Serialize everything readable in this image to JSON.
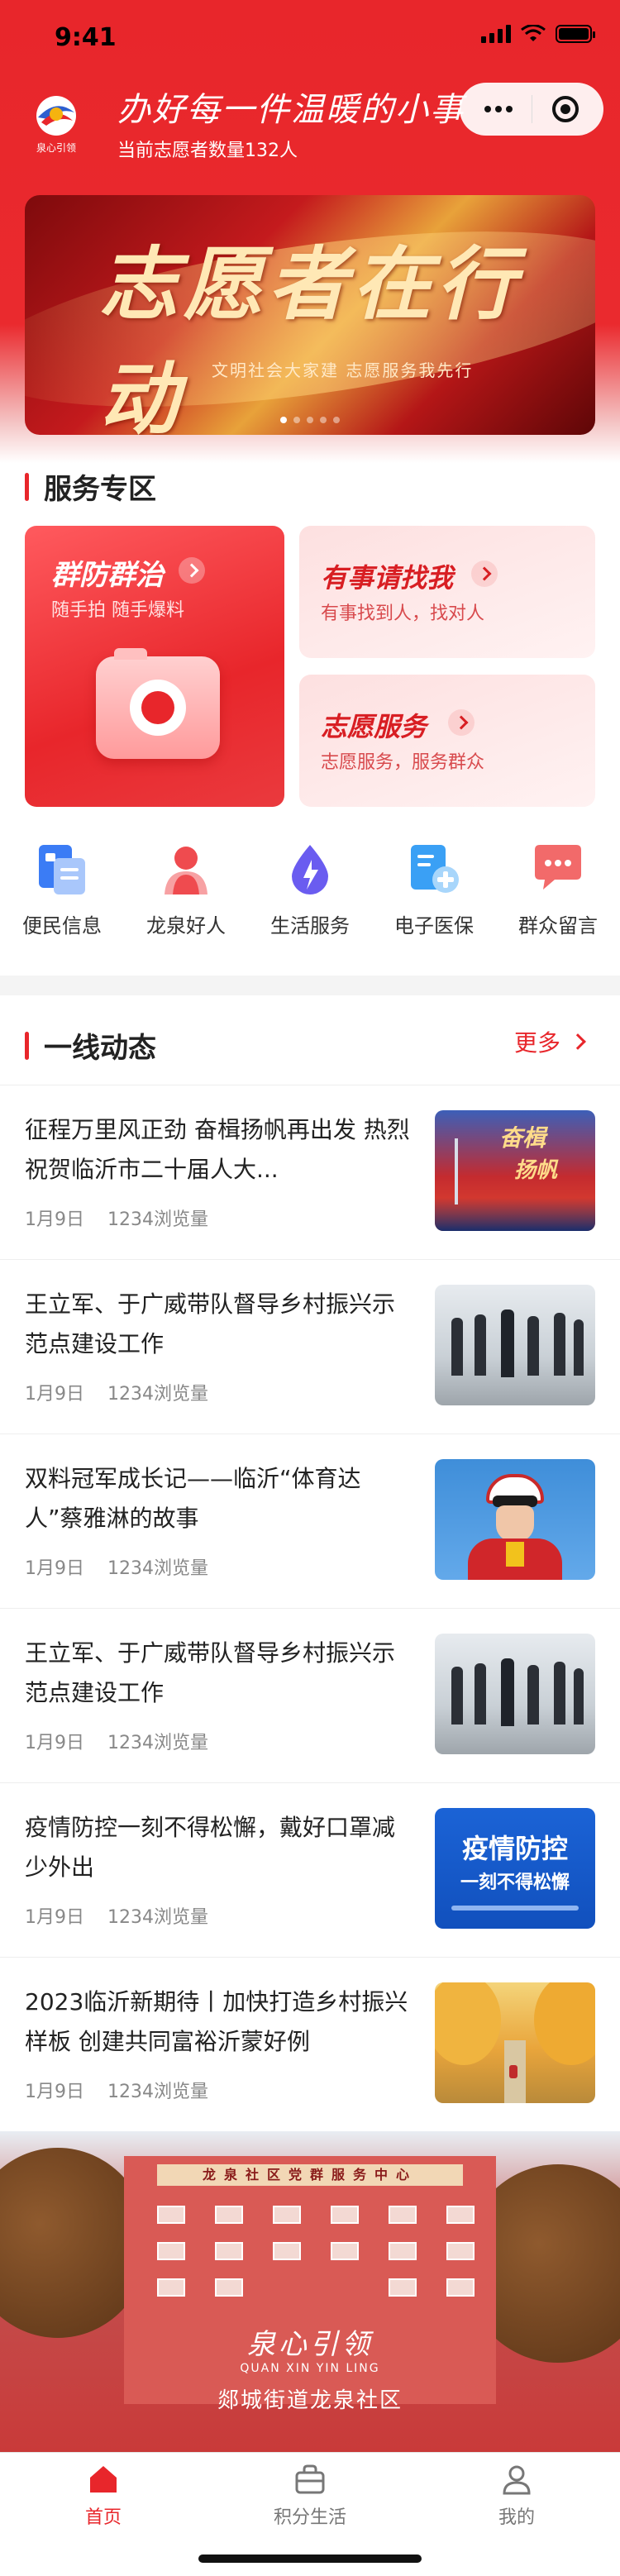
{
  "status_bar": {
    "time": "9:41"
  },
  "header": {
    "slogan": "办好每一件温暖的小事",
    "volunteer_count": "当前志愿者数量132人",
    "logo_text": "泉心引领"
  },
  "banner": {
    "title": "志愿者在行动",
    "subtitle": "文明社会大家建 志愿服务我先行",
    "dot_count": 5,
    "active_dot": 0
  },
  "service": {
    "section_title": "服务专区",
    "big_card": {
      "title": "群防群治",
      "subtitle": "随手拍 随手爆料",
      "icon": "camera-icon"
    },
    "cards": [
      {
        "title": "有事请找我",
        "subtitle": "有事找到人，找对人"
      },
      {
        "title": "志愿服务",
        "subtitle": "志愿服务，服务群众"
      }
    ]
  },
  "quick_entries": [
    {
      "label": "便民信息",
      "icon": "document-list-icon",
      "color": "#3b7cf5"
    },
    {
      "label": "龙泉好人",
      "icon": "person-icon",
      "color": "#ef4b4f"
    },
    {
      "label": "生活服务",
      "icon": "droplet-bolt-icon",
      "color": "#6a5cf0"
    },
    {
      "label": "电子医保",
      "icon": "medical-card-icon",
      "color": "#3aa0f5"
    },
    {
      "label": "群众留言",
      "icon": "message-icon",
      "color": "#f26a6a"
    }
  ],
  "news": {
    "section_title": "一线动态",
    "more_label": "更多",
    "items": [
      {
        "title": "征程万里风正劲 奋楫扬帆再出发 热烈祝贺临沂市二十届人大...",
        "date": "1月9日",
        "views": "1234浏览量",
        "thumb": "congress"
      },
      {
        "title": "王立军、于广威带队督导乡村振兴示范点建设工作",
        "date": "1月9日",
        "views": "1234浏览量",
        "thumb": "meeting"
      },
      {
        "title": "双料冠军成长记——临沂“体育达人”蔡雅淋的故事",
        "date": "1月9日",
        "views": "1234浏览量",
        "thumb": "athlete"
      },
      {
        "title": "王立军、于广威带队督导乡村振兴示范点建设工作",
        "date": "1月9日",
        "views": "1234浏览量",
        "thumb": "meeting"
      },
      {
        "title": "疫情防控一刻不得松懈，戴好口罩减少外出",
        "date": "1月9日",
        "views": "1234浏览量",
        "thumb": "epidemic"
      },
      {
        "title": "2023临沂新期待丨加快打造乡村振兴样板 创建共同富裕沂蒙好例",
        "date": "1月9日",
        "views": "1234浏览量",
        "thumb": "village"
      }
    ],
    "thumb_texts": {
      "congress_1": "奋楫",
      "congress_2": "扬帆",
      "epidemic_1": "疫情防控",
      "epidemic_2": "一刻不得松懈"
    }
  },
  "community": {
    "building_sign": "龙泉社区党群服务中心",
    "logo_title": "泉心引领",
    "logo_en": "QUAN XIN YIN LING",
    "subtitle": "郯城街道龙泉社区"
  },
  "tabbar": {
    "tabs": [
      {
        "label": "首页",
        "icon": "home-icon",
        "active": true
      },
      {
        "label": "积分生活",
        "icon": "bag-icon",
        "active": false
      },
      {
        "label": "我的",
        "icon": "user-icon",
        "active": false
      }
    ]
  },
  "colors": {
    "brand_red": "#e8262b"
  }
}
